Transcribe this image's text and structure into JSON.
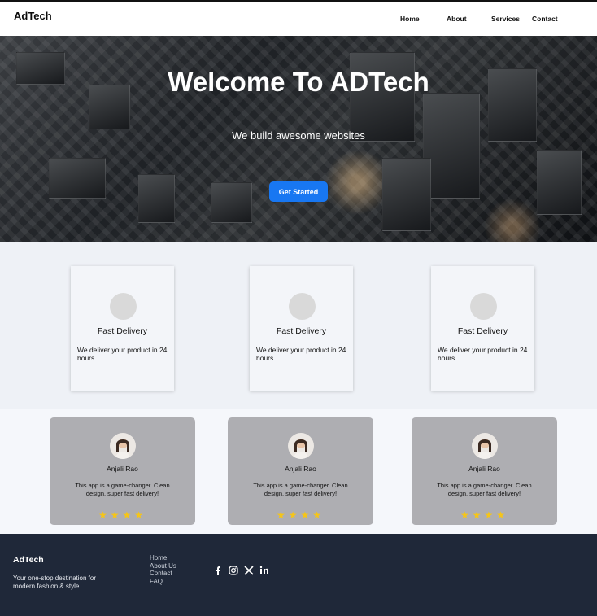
{
  "header": {
    "brand": "AdTech",
    "nav": [
      "Home",
      "About",
      "Services",
      "Contact"
    ]
  },
  "hero": {
    "title": "Welcome To ADTech",
    "subtitle": "We build awesome websites",
    "cta": "Get Started"
  },
  "features": [
    {
      "title": "Fast Delivery",
      "desc": "We deliver your product in 24 hours."
    },
    {
      "title": "Fast Delivery",
      "desc": "We deliver your product in 24 hours."
    },
    {
      "title": "Fast Delivery",
      "desc": "We deliver your product in 24 hours."
    }
  ],
  "testimonials": [
    {
      "name": "Anjali Rao",
      "quote": "This app is a game-changer. Clean design, super fast delivery!",
      "rating": 4
    },
    {
      "name": "Anjali Rao",
      "quote": "This app is a game-changer. Clean design, super fast delivery!",
      "rating": 4
    },
    {
      "name": "Anjali Rao",
      "quote": "This app is a game-changer. Clean design, super fast delivery!",
      "rating": 4
    }
  ],
  "footer": {
    "brand": "AdTech",
    "tagline": "Your one-stop destination for modern fashion & style.",
    "links": [
      "Home",
      "About Us",
      "Contact",
      "FAQ"
    ],
    "social": [
      "facebook-icon",
      "instagram-icon",
      "x-icon",
      "linkedin-icon"
    ]
  },
  "colors": {
    "accent": "#1877f2",
    "footer_bg": "#1f2839",
    "card_gray": "#aeaeb2",
    "star": "#f5c518"
  }
}
